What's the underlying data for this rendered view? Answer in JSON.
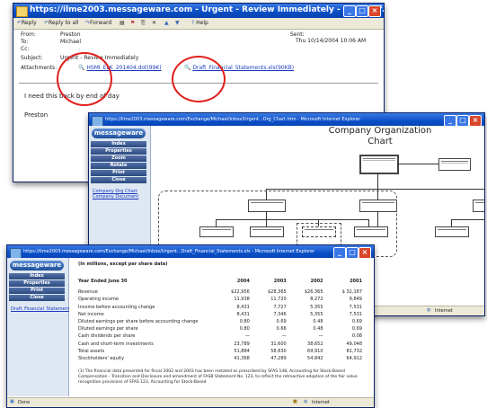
{
  "email_window": {
    "title": "https://ilme2003.messageware.com - Urgent - Review Immediately - Microsof...",
    "toolbar": {
      "reply": "Reply",
      "reply_all": "Reply to all",
      "forward": "Forward",
      "help": "Help"
    },
    "from_label": "From:",
    "from_value": "Preston",
    "to_label": "To:",
    "to_value": "Michael",
    "cc_label": "Cc:",
    "cc_value": "",
    "subject_label": "Subject:",
    "subject_value": "Urgent - Review Immediately",
    "attachments_label": "Attachments:",
    "attachment_1": "HSMI_ELK_201404.dot(99K)",
    "attachment_2": "Draft_Financial_Statements.xls(90KB)",
    "sent_label": "Sent:",
    "sent_value": "Thu 10/14/2004 10:06 AM",
    "body_line": "I need this back by end of day",
    "signature": "Preston"
  },
  "org_window": {
    "title": "https://ilme2003.messageware.com/Exchange/Michael/Inbox/Urgent...Org_Chart.htm - Microsoft Internet Explorer",
    "logo": "messageware",
    "nav": [
      "Index",
      "Properties",
      "Zoom",
      "Rotate",
      "Print",
      "Close"
    ],
    "sidebar_links": [
      "Company Org Chart",
      "Company Document"
    ],
    "heading_line1": "Company Organization",
    "heading_line2": "Chart",
    "status_zone": "Internet"
  },
  "fin_window": {
    "title": "https://ilme2003.messageware.com/Exchange/Michael/Inbox/Urgent...Draft_Financial_Statements.xls - Microsoft Internet Explorer",
    "logo": "messageware",
    "nav": [
      "Index",
      "Properties",
      "Print",
      "Close"
    ],
    "sidebar_link": "Draft_Financial_Statements.xls",
    "caption": "(In millions, except per share data)",
    "header": [
      "Year Ended June 30",
      "2004",
      "2003",
      "2002",
      "2001"
    ],
    "rows": [
      [
        "Revenue",
        "$22,956",
        "$28,365",
        "$26,365",
        "$ 32,187"
      ],
      [
        "Operating income",
        "11,938",
        "11,720",
        "8,272",
        "9,849"
      ],
      [
        "Income before accounting change",
        "8,431",
        "7,727",
        "5,355",
        "7,531"
      ],
      [
        "Net income",
        "8,431",
        "7,346",
        "5,355",
        "7,531"
      ],
      [
        "Diluted earnings per share before accounting change",
        "0.80",
        "0.69",
        "0.48",
        "0.69"
      ],
      [
        "Diluted earnings per share",
        "0.80",
        "0.66",
        "0.48",
        "0.69"
      ],
      [
        "Cash dividends per share",
        "—",
        "—",
        "—",
        "0.08"
      ],
      [
        "Cash and short-term investments",
        "23,789",
        "31,600",
        "38,652",
        "49,048"
      ],
      [
        "Total assets",
        "51,884",
        "58,830",
        "69,910",
        "81,732"
      ],
      [
        "Stockholders' equity",
        "41,368",
        "47,289",
        "54,842",
        "64,912"
      ]
    ],
    "footnote": "(1)   The financial data presented for fiscal 2002 and 2003 has been restated as prescribed by SFAS 148, Accounting for Stock-Based Compensation - Transition and Disclosure and amendment of FASB Statement No. 123, to reflect the retroactive adoption of the fair value recognition provisions of SFAS 123, Accounting for Stock-Based",
    "status_done": "Done",
    "status_zone": "Internet"
  }
}
